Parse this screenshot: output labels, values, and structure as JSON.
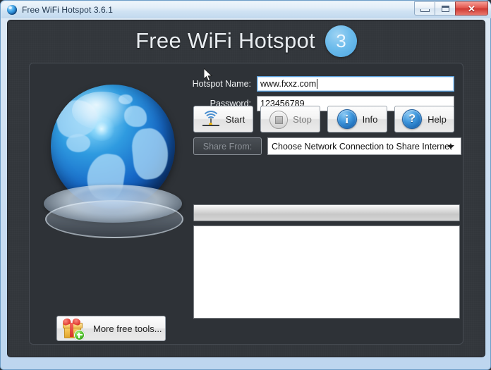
{
  "window": {
    "title": "Free WiFi Hotspot 3.6.1",
    "icon": "globe-icon",
    "buttons": {
      "minimize": "minimize-icon",
      "maximize": "maximize-icon",
      "close": "✕"
    }
  },
  "header": {
    "app_title": "Free WiFi Hotspot",
    "version_badge": "3"
  },
  "illustration": {
    "name": "globe-illustration"
  },
  "more_tools": {
    "label": "More free tools...",
    "icon": "gift-icon"
  },
  "form": {
    "hotspot_name": {
      "label": "Hotspot Name:",
      "value": "www.fxxz.com",
      "placeholder": "",
      "focused": true
    },
    "password": {
      "label": "Password:",
      "value": "123456789",
      "placeholder": ""
    }
  },
  "actions": [
    {
      "label": "Start",
      "icon": "wifi-icon",
      "enabled": true
    },
    {
      "label": "Stop",
      "icon": "stop-icon",
      "enabled": false
    },
    {
      "label": "Info",
      "icon": "info-icon",
      "enabled": true
    },
    {
      "label": "Help",
      "icon": "help-icon",
      "enabled": true
    }
  ],
  "share": {
    "button_label": "Share From:",
    "button_enabled": false,
    "select_value": "Choose Network Connection to Share Internet",
    "arrow_icon": "chevron-down-icon"
  },
  "status": {
    "strip_text": "",
    "list_items": []
  },
  "colors": {
    "accent_blue": "#4da6e0",
    "app_background": "#32363b",
    "panel_background": "#2e3237",
    "title_text": "#e9edf1",
    "frame_blue": "#bdd6ef"
  }
}
